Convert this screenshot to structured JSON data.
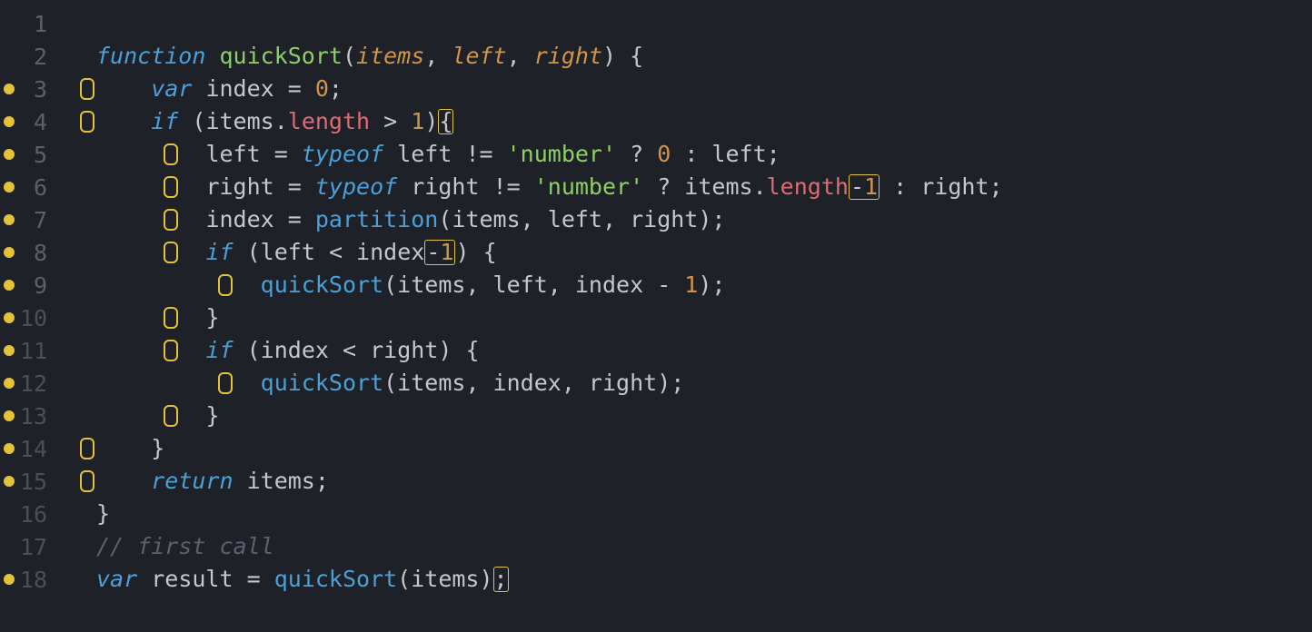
{
  "colors": {
    "background": "#1e2127",
    "breakpoint": "#e3c23c",
    "keyword": "#4aa0d8",
    "function_name": "#8ecf67",
    "property": "#e06b74",
    "number": "#d1944a",
    "string": "#8ecf67",
    "comment": "#5b616c",
    "default": "#c4c7cc",
    "line_number": "#5b616c"
  },
  "gutter": {
    "breakpoints_on_lines": [
      3,
      4,
      5,
      6,
      7,
      8,
      9,
      10,
      11,
      12,
      13,
      14,
      15,
      18
    ],
    "coverage_markers": [
      {
        "line": 3,
        "indent": 1
      },
      {
        "line": 4,
        "indent": 1
      },
      {
        "line": 5,
        "indent": 2
      },
      {
        "line": 6,
        "indent": 2
      },
      {
        "line": 7,
        "indent": 2
      },
      {
        "line": 8,
        "indent": 2
      },
      {
        "line": 9,
        "indent": 3
      },
      {
        "line": 10,
        "indent": 2
      },
      {
        "line": 11,
        "indent": 2
      },
      {
        "line": 12,
        "indent": 3
      },
      {
        "line": 13,
        "indent": 2
      },
      {
        "line": 14,
        "indent": 1
      },
      {
        "line": 15,
        "indent": 1
      }
    ]
  },
  "lines": {
    "n1": "1",
    "n2": "2",
    "n3": "3",
    "n4": "4",
    "n5": "5",
    "n6": "6",
    "n7": "7",
    "n8": "8",
    "n9": "9",
    "n10": "10",
    "n11": "11",
    "n12": "12",
    "n13": "13",
    "n14": "14",
    "n15": "15",
    "n16": "16",
    "n17": "17",
    "n18": "18"
  },
  "code": {
    "l2": {
      "kw": "function",
      "sp": " ",
      "name": "quickSort",
      "op": "(",
      "p1": "items",
      "c": ", ",
      "p2": "left",
      "p3": "right",
      "cp": ")",
      "sp2": " ",
      "ob": "{"
    },
    "l3": {
      "decl": "var",
      "sp": " ",
      "id": "index",
      "eq": " = ",
      "num": "0",
      "sc": ";"
    },
    "l4": {
      "kw": "if",
      "sp": " ",
      "op": "(",
      "id": "items",
      "dot": ".",
      "prop": "length",
      "cmp": " > ",
      "num": "1",
      "cp": ")",
      "hl": "{"
    },
    "l5": {
      "id": "left",
      "eq": " = ",
      "type": "typeof",
      "sp": " ",
      "id2": "left",
      "cmp": " != ",
      "str": "'number'",
      "tern": " ? ",
      "num": "0",
      "alt": " : ",
      "id3": "left",
      "sc": ";"
    },
    "l6": {
      "id": "right",
      "eq": " = ",
      "type": "typeof",
      "sp": " ",
      "id2": "right",
      "cmp": " != ",
      "str": "'number'",
      "tern": " ? ",
      "id3": "items",
      "dot": ".",
      "prop": "length",
      "hl": "-1",
      "alt": " : ",
      "id4": "right",
      "sc": ";"
    },
    "l7": {
      "id": "index",
      "eq": " = ",
      "call": "partition",
      "op": "(",
      "a1": "items",
      "c": ", ",
      "a2": "left",
      "a3": "right",
      "cp": ")",
      "sc": ";"
    },
    "l8": {
      "kw": "if",
      "sp": " ",
      "op": "(",
      "id": "left",
      "cmp": " < ",
      "id2": "index",
      "hl": "-1",
      "cp": ")",
      "sp2": " ",
      "ob": "{"
    },
    "l9": {
      "call": "quickSort",
      "op": "(",
      "a1": "items",
      "c": ", ",
      "a2": "left",
      "a3": "index",
      "mws": " - ",
      "a4": "1",
      "cp": ")",
      "sc": ";"
    },
    "l10": {
      "cb": "}"
    },
    "l11": {
      "kw": "if",
      "sp": " ",
      "op": "(",
      "id": "index",
      "cmp": " < ",
      "id2": "right",
      "cp": ")",
      "sp2": " ",
      "ob": "{"
    },
    "l12": {
      "call": "quickSort",
      "op": "(",
      "a1": "items",
      "c": ", ",
      "a2": "index",
      "a3": "right",
      "cp": ")",
      "sc": ";"
    },
    "l13": {
      "cb": "}"
    },
    "l14": {
      "cb": "}"
    },
    "l15": {
      "kw": "return",
      "sp": " ",
      "id": "items",
      "sc": ";"
    },
    "l16": {
      "cb": "}"
    },
    "l17": {
      "cmnt": "// first call"
    },
    "l18": {
      "decl": "var",
      "sp": " ",
      "id": "result",
      "eq": " = ",
      "call": "quickSort",
      "op": "(",
      "a1": "items",
      "cp": ")",
      "hl": ";"
    }
  }
}
